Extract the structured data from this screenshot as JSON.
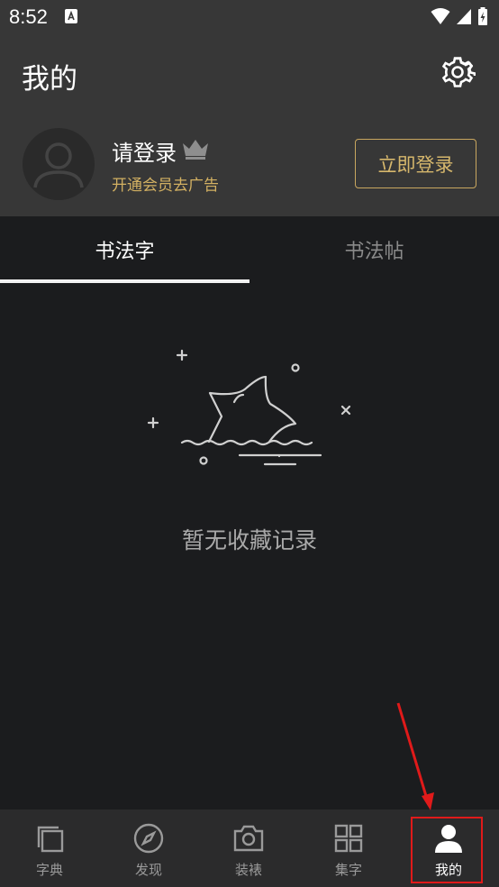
{
  "status_bar": {
    "time": "8:52"
  },
  "header": {
    "title": "我的"
  },
  "profile": {
    "login_prompt": "请登录",
    "vip_text": "开通会员去广告",
    "login_button": "立即登录"
  },
  "tabs": [
    {
      "label": "书法字"
    },
    {
      "label": "书法帖"
    }
  ],
  "empty_state": {
    "message": "暂无收藏记录"
  },
  "bottom_nav": [
    {
      "label": "字典",
      "icon": "layers-icon"
    },
    {
      "label": "发现",
      "icon": "compass-icon"
    },
    {
      "label": "装裱",
      "icon": "camera-icon"
    },
    {
      "label": "集字",
      "icon": "grid-icon"
    },
    {
      "label": "我的",
      "icon": "person-icon"
    }
  ],
  "colors": {
    "accent_gold": "#c9a75f",
    "highlight_red": "#e01a1a",
    "header_bg": "#373737",
    "page_bg": "#1b1c1e"
  }
}
